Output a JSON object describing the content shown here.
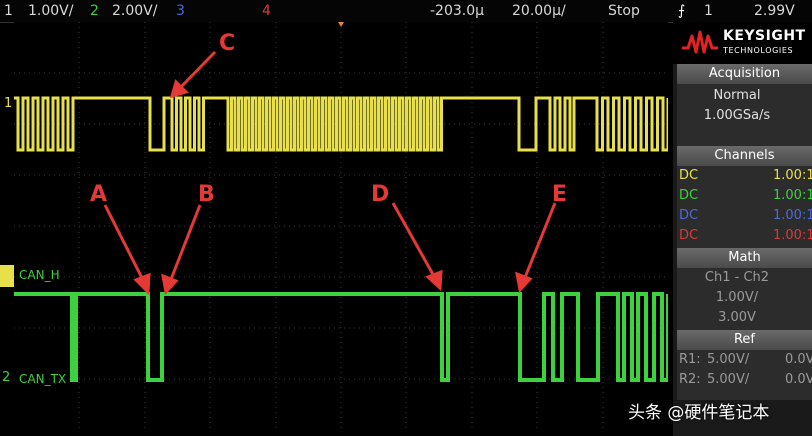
{
  "topbar": {
    "ch1_num": "1",
    "ch1_scale": "1.00V/",
    "ch2_num": "2",
    "ch2_scale": "2.00V/",
    "ch3_num": "3",
    "ch4_num": "4",
    "time_offset": "-203.0µ",
    "time_scale": "20.00µ/",
    "run_state": "Stop",
    "trigger_icon": "trigger-edge-icon",
    "trigger_source": "1",
    "trigger_level": "2.99V"
  },
  "panel": {
    "brand": "KEYSIGHT",
    "brand_sub": "TECHNOLOGIES",
    "acquisition": {
      "title": "Acquisition",
      "mode": "Normal",
      "rate": "1.00GSa/s"
    },
    "channels": {
      "title": "Channels",
      "rows": [
        {
          "coupling": "DC",
          "ratio": "1.00:1",
          "color": "#e8e04a"
        },
        {
          "coupling": "DC",
          "ratio": "1.00:1",
          "color": "#3ed13e"
        },
        {
          "coupling": "DC",
          "ratio": "1.00:1",
          "color": "#4a6ad8"
        },
        {
          "coupling": "DC",
          "ratio": "1.00:1",
          "color": "#d83a3a"
        }
      ]
    },
    "math": {
      "title": "Math",
      "expr": "Ch1 - Ch2",
      "scale": "1.00V/",
      "offset": "3.00V"
    },
    "ref": {
      "title": "Ref",
      "r1_label": "R1:",
      "r1_scale": "5.00V/",
      "r1_offset": "0.0V",
      "r2_label": "R2:",
      "r2_scale": "5.00V/",
      "r2_offset": "0.0V"
    }
  },
  "traces": {
    "ch1_marker": "1",
    "ch2_marker": "2",
    "can_h_label": "CAN_H",
    "can_tx_label": "CAN_TX"
  },
  "annotations": {
    "a": "A",
    "b": "B",
    "c": "C",
    "d": "D",
    "e": "E"
  },
  "watermark": "头条 @硬件笔记本",
  "colors": {
    "ch1": "#e8e04a",
    "ch2": "#3ed13e",
    "annotation": "#e53935"
  }
}
